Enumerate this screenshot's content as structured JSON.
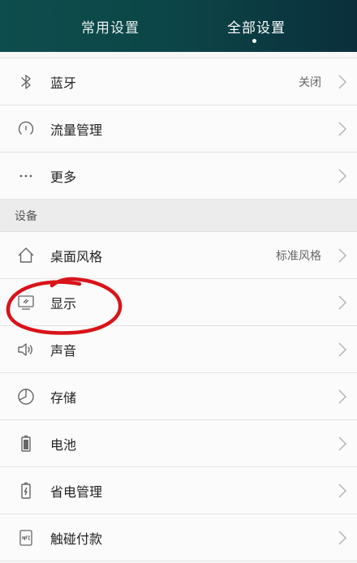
{
  "tabs": [
    {
      "label": "常用设置",
      "active": false
    },
    {
      "label": "全部设置",
      "active": true
    }
  ],
  "rows_top": [
    {
      "label": "蓝牙",
      "value": "关闭",
      "icon": "bluetooth-icon"
    },
    {
      "label": "流量管理",
      "value": "",
      "icon": "data-usage-icon"
    },
    {
      "label": "更多",
      "value": "",
      "icon": "more-icon"
    }
  ],
  "section": {
    "title": "设备"
  },
  "rows_device": [
    {
      "label": "桌面风格",
      "value": "标准风格",
      "icon": "home-icon"
    },
    {
      "label": "显示",
      "value": "",
      "icon": "display-icon"
    },
    {
      "label": "声音",
      "value": "",
      "icon": "speaker-icon"
    },
    {
      "label": "存储",
      "value": "",
      "icon": "storage-pie-icon"
    },
    {
      "label": "电池",
      "value": "",
      "icon": "battery-icon"
    },
    {
      "label": "省电管理",
      "value": "",
      "icon": "power-saving-icon"
    },
    {
      "label": "触碰付款",
      "value": "",
      "icon": "nfc-icon"
    }
  ],
  "colors": {
    "header_start": "#0e4d4d",
    "header_end": "#0a2f3b",
    "annotation": "#d8141a"
  }
}
